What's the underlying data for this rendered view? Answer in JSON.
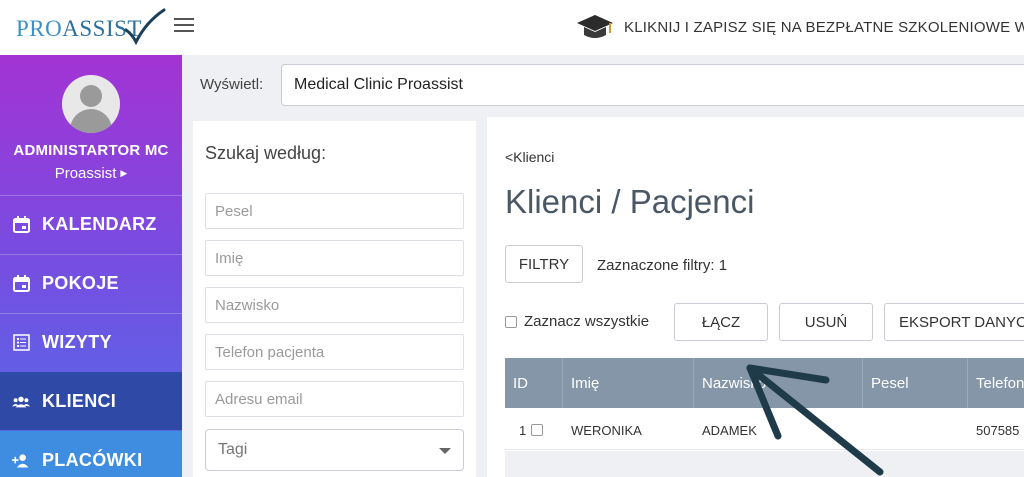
{
  "header": {
    "logo_text_pro": "PRO",
    "logo_text_assist": "ASSIST",
    "promo_text": "KLIKNIJ I ZAPISZ SIĘ NA BEZPŁATNE SZKOLENIOWE W"
  },
  "sidebar": {
    "user_name": "ADMINISTARTOR MC",
    "user_org": "Proassist",
    "items": [
      {
        "label": "KALENDARZ",
        "icon": "calendar-icon"
      },
      {
        "label": "POKOJE",
        "icon": "calendar-icon"
      },
      {
        "label": "WIZYTY",
        "icon": "list-icon"
      },
      {
        "label": "KLIENCI",
        "icon": "users-icon"
      },
      {
        "label": "PLACÓWKI",
        "icon": "add-user-icon"
      }
    ],
    "active_item": "KLIENCI"
  },
  "display": {
    "label": "Wyświetl:",
    "value": "Medical Clinic Proassist"
  },
  "search": {
    "title": "Szukaj według:",
    "pesel_placeholder": "Pesel",
    "firstname_placeholder": "Imię",
    "lastname_placeholder": "Nazwisko",
    "phone_placeholder": "Telefon pacjenta",
    "email_placeholder": "Adresu email",
    "tags_placeholder": "Tagi"
  },
  "main": {
    "breadcrumb": "<Klienci",
    "title": "Klienci / Pacjenci",
    "filter_button": "FILTRY",
    "filter_info": "Zaznaczone filtry: 1",
    "select_all": "Zaznacz wszystkie",
    "merge_button": "ŁĄCZ",
    "delete_button": "USUŃ",
    "export_button": "EKSPORT DANYC"
  },
  "table": {
    "columns": [
      "ID",
      "Imię",
      "Nazwisko",
      "Pesel",
      "Telefon"
    ],
    "rows": [
      {
        "id": "1",
        "first_name": "WERONIKA",
        "last_name": "ADAMEK",
        "pesel": "",
        "phone": "507585"
      }
    ]
  },
  "colors": {
    "sidebar_top": "#a333d4",
    "sidebar_bottom": "#4f6ee8",
    "active_nav": "#2f4aa6",
    "table_header": "#8496a8",
    "arrow": "#1f3b4a"
  }
}
